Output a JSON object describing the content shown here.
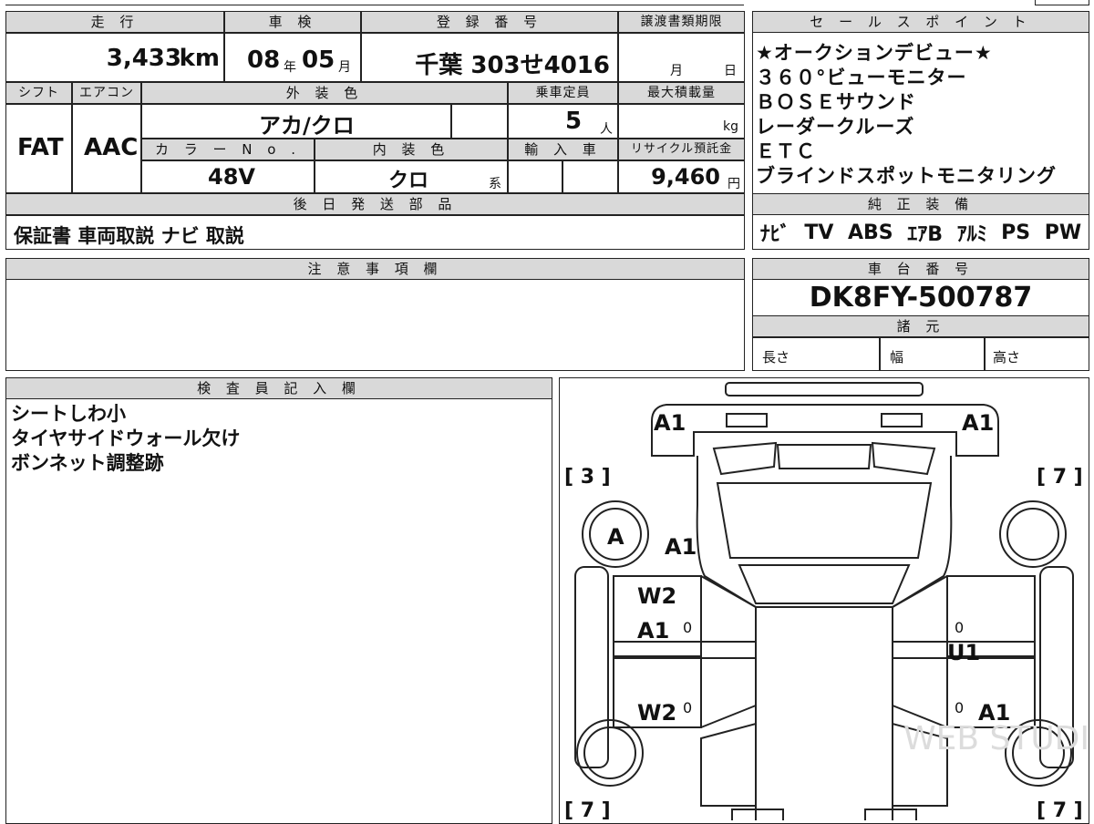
{
  "sheet": {
    "mileage": {
      "label": "走 行",
      "value": "3,433",
      "unit": "km"
    },
    "inspection": {
      "label": "車 検",
      "year": "08",
      "year_unit": "年",
      "month": "05",
      "month_unit": "月"
    },
    "registration": {
      "label": "登 録 番 号",
      "value": "千葉 303せ4016"
    },
    "transfer": {
      "label": "譲渡書類期限",
      "month_unit": "月",
      "day_unit": "日"
    },
    "shift": {
      "label": "シフト",
      "value": "FAT"
    },
    "aircon": {
      "label": "エアコン",
      "value": "AAC"
    },
    "exterior": {
      "label": "外 装 色",
      "value": "アカ/クロ"
    },
    "capacity": {
      "label": "乗車定員",
      "value": "5",
      "unit": "人"
    },
    "max_load": {
      "label": "最大積載量",
      "unit": "kg"
    },
    "color_no": {
      "label": "カ ラ ー N o .",
      "value": "48V"
    },
    "interior": {
      "label": "内 装 色",
      "value": "クロ",
      "suffix": "系"
    },
    "import": {
      "label": "輸 入 車"
    },
    "recycle": {
      "label": "リサイクル預託金",
      "value": "9,460",
      "unit": "円"
    },
    "later_parts": {
      "label": "後 日 発 送 部 品",
      "value": "保証書 車両取説 ナビ 取説"
    },
    "sales_points": {
      "label": "セ ー ル ス ポ イ ン ト",
      "items": [
        "★オークションデビュー★",
        "３６０°ビューモニター",
        "ＢＯＳＥサウンド",
        "レーダークルーズ",
        "ＥＴＣ",
        "ブラインドスポットモニタリング"
      ]
    },
    "equipment": {
      "label": "純 正 装 備",
      "items": [
        "ﾅﾋﾞ",
        "TV",
        "ABS",
        "ｴｱB",
        "ｱﾙﾐ",
        "PS",
        "PW"
      ]
    },
    "notes": {
      "label": "注 意 事 項 欄",
      "value": ""
    },
    "chassis": {
      "label": "車 台 番 号",
      "value": "DK8FY-500787"
    },
    "specs": {
      "label": "諸 元",
      "length": "長さ",
      "width": "幅",
      "height": "高さ"
    },
    "inspector": {
      "label": "検 査 員 記 入 欄",
      "lines": [
        "シートしわ小",
        "タイヤサイドウォール欠け",
        "ボンネット調整跡"
      ]
    },
    "diagram": {
      "marks": {
        "front_left": "A1",
        "front_right": "A1",
        "wheel_fl": "A",
        "fender_fl": "A1",
        "door_fl_1": "W2",
        "door_fl_2": "A1",
        "door_rl": "W2",
        "door_fr": "U1",
        "door_rr": "A1",
        "zero": "0"
      },
      "tire_tl": "[ 3 ]",
      "tire_tr": "[ 7 ]",
      "tire_bl": "[ 7 ]",
      "tire_br": "[ 7 ]",
      "watermark": "WEB STUDIO PRO"
    }
  }
}
